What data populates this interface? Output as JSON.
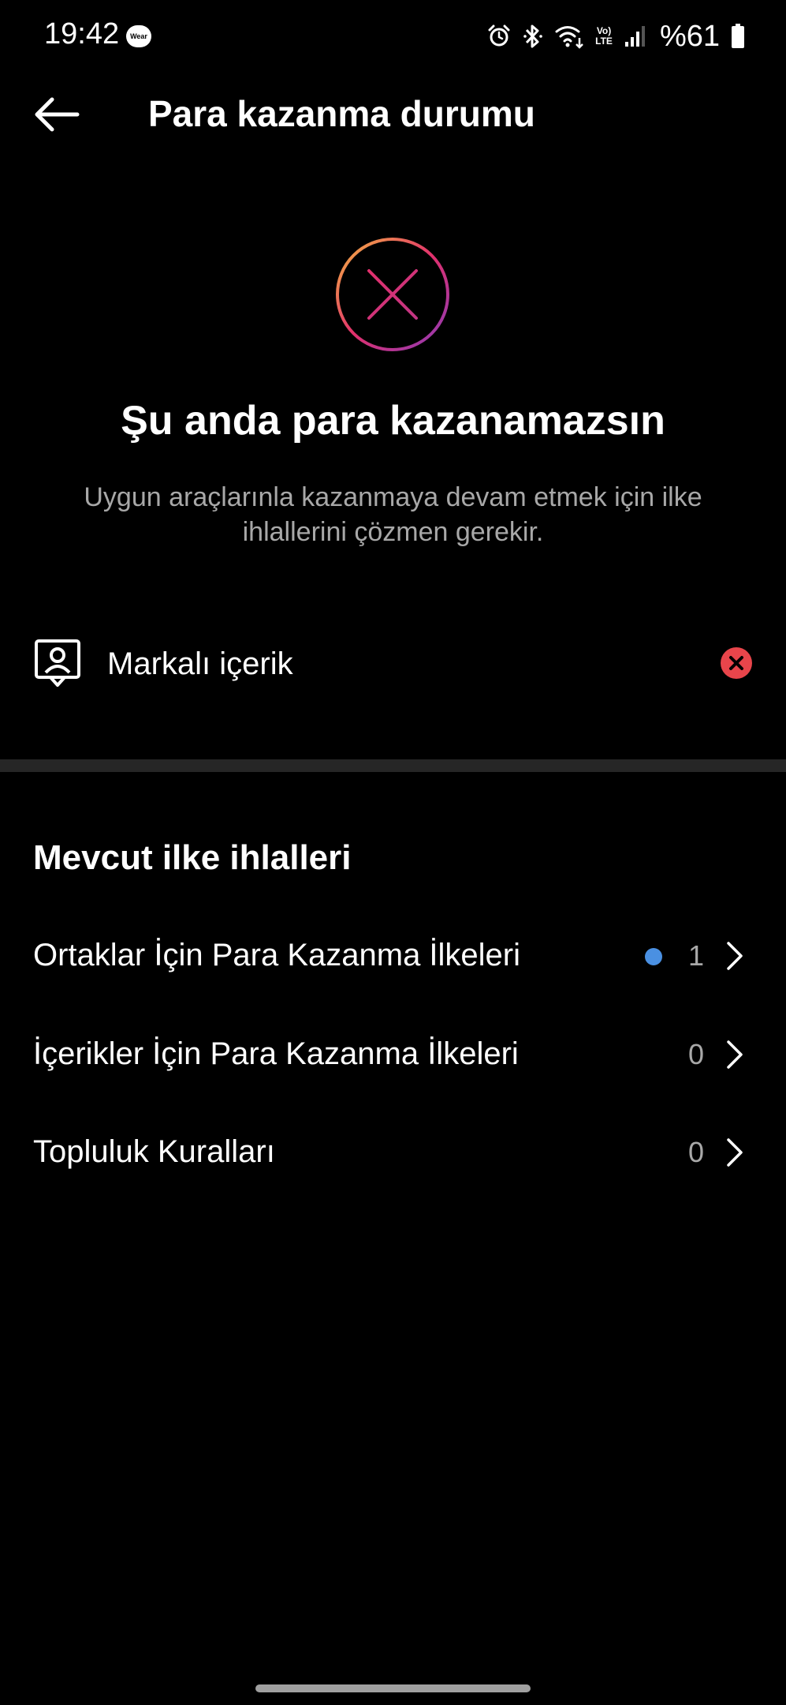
{
  "status_bar": {
    "time": "19:42",
    "wear_badge": "Wear",
    "volte_top": "Vo)",
    "volte_bottom": "LTE",
    "battery": "%61",
    "icons": [
      "alarm-icon",
      "bluetooth-icon",
      "wifi-icon",
      "volte-icon",
      "signal-icon",
      "battery-icon"
    ]
  },
  "header": {
    "title": "Para kazanma durumu",
    "back_icon": "back-arrow-icon"
  },
  "hero": {
    "icon": "x-circle-gradient-icon",
    "title": "Şu anda para kazanamazsın",
    "subtitle": "Uygun araçlarınla kazanmaya devam etmek için ilke ihlallerini çözmen gerekir."
  },
  "feature": {
    "label": "Markalı içerik",
    "icon": "branded-content-icon",
    "status_icon": "error-x-icon"
  },
  "violations": {
    "title": "Mevcut ilke ihlalleri",
    "items": [
      {
        "label": "Ortaklar İçin Para Kazanma İlkeleri",
        "count": "1",
        "has_unread_dot": true
      },
      {
        "label": "İçerikler İçin Para Kazanma İlkeleri",
        "count": "0",
        "has_unread_dot": false
      },
      {
        "label": "Topluluk Kuralları",
        "count": "0",
        "has_unread_dot": false
      }
    ]
  },
  "colors": {
    "background": "#000000",
    "text_primary": "#ffffff",
    "text_secondary": "#a8a8a8",
    "error_red": "#e8454b",
    "unread_dot": "#4a90e2",
    "divider": "#262626",
    "gradient_start": "#f5b73f",
    "gradient_mid": "#e1306c",
    "gradient_end": "#8a3ab9"
  }
}
